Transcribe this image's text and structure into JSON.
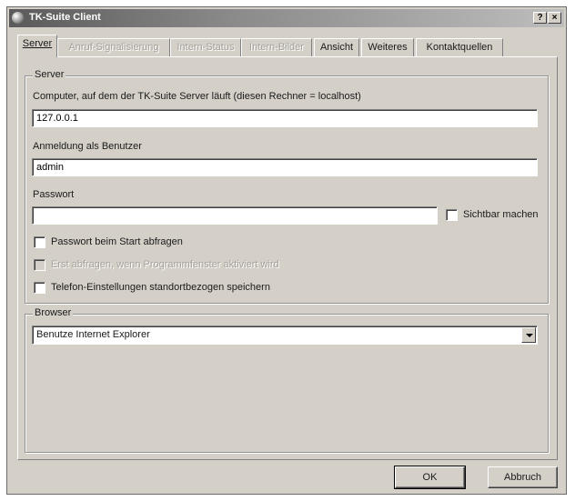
{
  "window": {
    "title": "TK-Suite Client",
    "help_label": "?",
    "close_label": "×"
  },
  "tabs": [
    {
      "label": "Server",
      "state": "active"
    },
    {
      "label": "Anruf-Signalisierung",
      "state": "disabled"
    },
    {
      "label": "Intern-Status",
      "state": "disabled"
    },
    {
      "label": "Intern-Bilder",
      "state": "disabled"
    },
    {
      "label": "Ansicht",
      "state": "enabled"
    },
    {
      "label": "Weiteres",
      "state": "enabled"
    },
    {
      "label": "Kontaktquellen",
      "state": "enabled"
    }
  ],
  "server": {
    "group_label": "Server",
    "computer_label": "Computer, auf dem der TK-Suite Server läuft (diesen Rechner = localhost)",
    "computer_value": "127.0.0.1",
    "user_label": "Anmeldung als Benutzer",
    "user_value": "admin",
    "password_label": "Passwort",
    "password_value": "",
    "show_password_label": "Sichtbar machen",
    "show_password_checked": false,
    "ask_password_label": "Passwort beim Start abfragen",
    "ask_password_checked": false,
    "ask_on_activate_label": "Erst abfragen, wenn Programmfenster aktiviert wird",
    "ask_on_activate_checked": false,
    "save_location_label": "Telefon-Einstellungen standortbezogen speichern",
    "save_location_checked": false
  },
  "browser": {
    "group_label": "Browser",
    "selected": "Benutze Internet Explorer"
  },
  "buttons": {
    "ok_label": "OK",
    "cancel_label": "Abbruch"
  }
}
